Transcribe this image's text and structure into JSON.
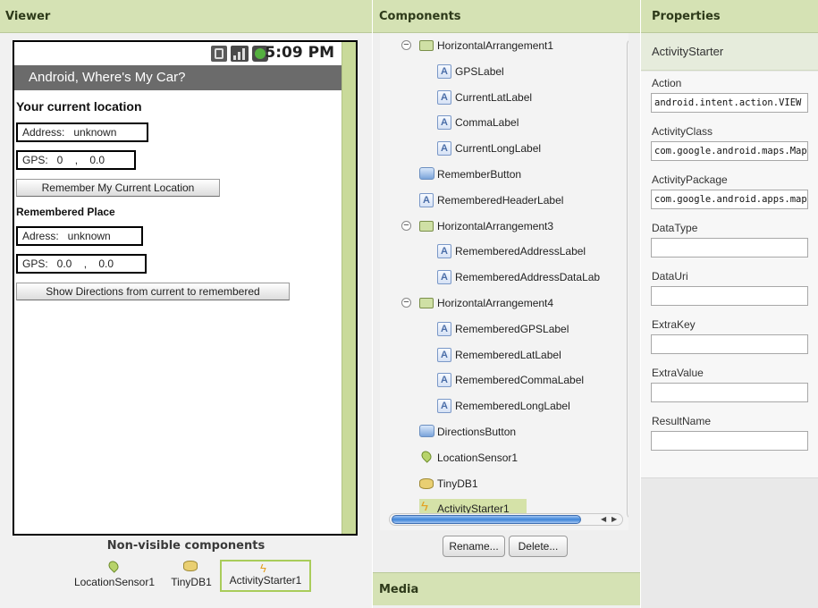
{
  "panels": {
    "viewer": "Viewer",
    "components": "Components",
    "properties": "Properties",
    "media": "Media"
  },
  "phone": {
    "time": "5:09 PM",
    "app_title": "Android, Where's My Car?",
    "current_location_heading": "Your current location",
    "address_text": "Address:   unknown",
    "gps_text": "GPS:   0    ,    0.0",
    "remember_button": "Remember My Current Location",
    "remembered_heading": "Remembered Place",
    "remembered_address_text": "Adress:   unknown",
    "remembered_gps_text": "GPS:   0.0    ,    0.0",
    "directions_button": "Show Directions from current to remembered"
  },
  "non_visible": {
    "title": "Non-visible components",
    "items": [
      "LocationSensor1",
      "TinyDB1",
      "ActivityStarter1"
    ],
    "selected": "ActivityStarter1"
  },
  "tree": [
    {
      "label": "HorizontalArrangement1",
      "icon": "horizontal-arrangement-icon",
      "collapsible": true
    },
    {
      "label": "GPSLabel",
      "icon": "label-icon"
    },
    {
      "label": "CurrentLatLabel",
      "icon": "label-icon"
    },
    {
      "label": "CommaLabel",
      "icon": "label-icon"
    },
    {
      "label": "CurrentLongLabel",
      "icon": "label-icon"
    },
    {
      "label": "RememberButton",
      "icon": "button-icon"
    },
    {
      "label": "RememberedHeaderLabel",
      "icon": "label-icon"
    },
    {
      "label": "HorizontalArrangement3",
      "icon": "horizontal-arrangement-icon",
      "collapsible": true
    },
    {
      "label": "RememberedAddressLabel",
      "icon": "label-icon"
    },
    {
      "label": "RememberedAddressDataLab",
      "icon": "label-icon"
    },
    {
      "label": "HorizontalArrangement4",
      "icon": "horizontal-arrangement-icon",
      "collapsible": true
    },
    {
      "label": "RememberedGPSLabel",
      "icon": "label-icon"
    },
    {
      "label": "RememberedLatLabel",
      "icon": "label-icon"
    },
    {
      "label": "RememberedCommaLabel",
      "icon": "label-icon"
    },
    {
      "label": "RememberedLongLabel",
      "icon": "label-icon"
    },
    {
      "label": "DirectionsButton",
      "icon": "button-icon"
    },
    {
      "label": "LocationSensor1",
      "icon": "location-sensor-icon"
    },
    {
      "label": "TinyDB1",
      "icon": "database-icon"
    },
    {
      "label": "ActivityStarter1",
      "icon": "activity-starter-icon",
      "selected": true
    }
  ],
  "component_buttons": {
    "rename": "Rename...",
    "delete": "Delete..."
  },
  "properties": {
    "component_name": "ActivityStarter",
    "fields": [
      {
        "label": "Action",
        "value": "android.intent.action.VIEW"
      },
      {
        "label": "ActivityClass",
        "value": "com.google.android.maps.MapsActivity"
      },
      {
        "label": "ActivityPackage",
        "value": "com.google.android.apps.maps"
      },
      {
        "label": "DataType",
        "value": ""
      },
      {
        "label": "DataUri",
        "value": ""
      },
      {
        "label": "ExtraKey",
        "value": ""
      },
      {
        "label": "ExtraValue",
        "value": ""
      },
      {
        "label": "ResultName",
        "value": ""
      }
    ]
  },
  "colors": {
    "header_bg": "#d5e2b4",
    "selection": "#d5e2a8",
    "scroll_thumb": "#3e85d8"
  }
}
